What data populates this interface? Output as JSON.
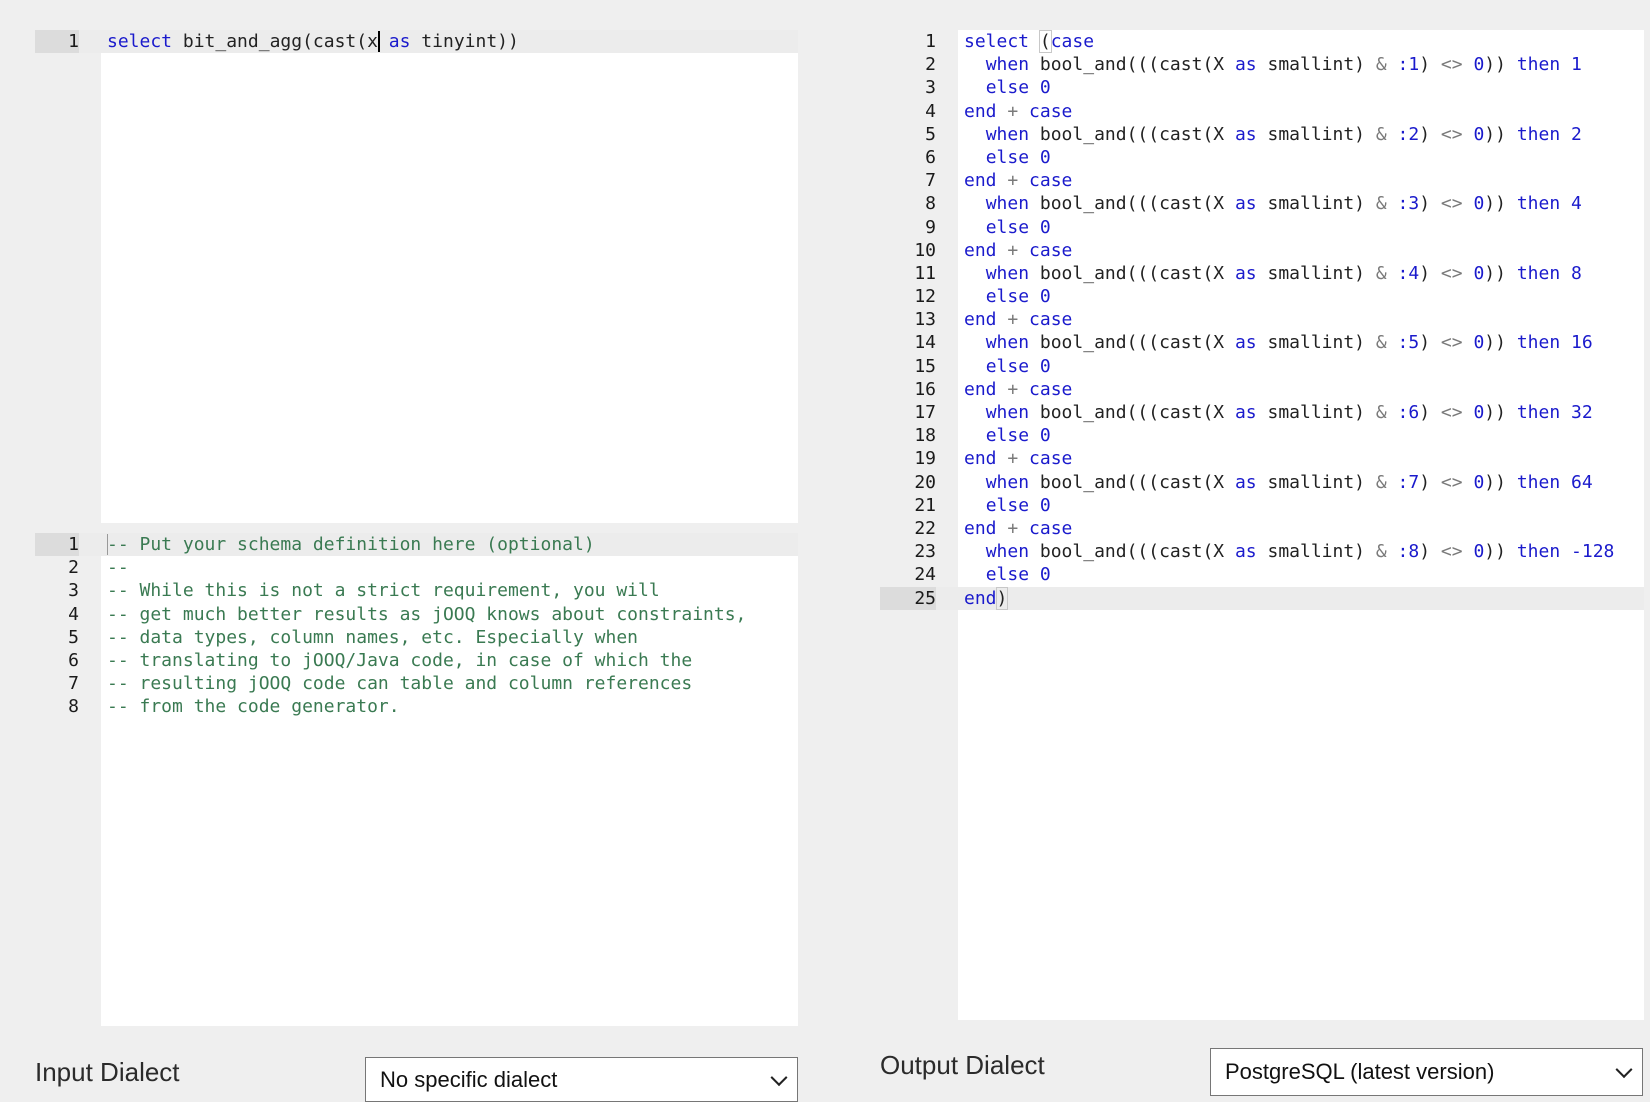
{
  "input_query": {
    "lines": [
      [
        {
          "t": "select",
          "c": "kw"
        },
        {
          "t": " bit_and_agg(cast(x",
          "c": "plain"
        },
        {
          "t": "",
          "c": "cursor"
        },
        {
          "t": " ",
          "c": "plain"
        },
        {
          "t": "as",
          "c": "kw"
        },
        {
          "t": " tinyint))",
          "c": "plain"
        }
      ]
    ]
  },
  "schema_editor": {
    "lines": [
      [
        {
          "t": "",
          "c": "cursor-light"
        },
        {
          "t": "-- Put your schema definition here (optional)",
          "c": "cm"
        }
      ],
      [
        {
          "t": "--",
          "c": "cm"
        }
      ],
      [
        {
          "t": "-- While this is not a strict requirement, you will",
          "c": "cm"
        }
      ],
      [
        {
          "t": "-- get much better results as jOOQ knows about constraints,",
          "c": "cm"
        }
      ],
      [
        {
          "t": "-- data types, column names, etc. Especially when",
          "c": "cm"
        }
      ],
      [
        {
          "t": "-- translating to jOOQ/Java code, in case of which the",
          "c": "cm"
        }
      ],
      [
        {
          "t": "-- resulting jOOQ code can table and column references",
          "c": "cm"
        }
      ],
      [
        {
          "t": "-- from the code generator.",
          "c": "cm"
        }
      ]
    ]
  },
  "output_query": {
    "lines": [
      [
        {
          "t": "select",
          "c": "kw"
        },
        {
          "t": " ",
          "c": "plain"
        },
        {
          "t": "(",
          "c": "bracket"
        },
        {
          "t": "case",
          "c": "kw"
        }
      ],
      [
        {
          "t": "  ",
          "c": "plain"
        },
        {
          "t": "when",
          "c": "kw"
        },
        {
          "t": " bool_and(((cast(X ",
          "c": "plain"
        },
        {
          "t": "as",
          "c": "kw"
        },
        {
          "t": " smallint) ",
          "c": "plain"
        },
        {
          "t": "&",
          "c": "op"
        },
        {
          "t": " ",
          "c": "plain"
        },
        {
          "t": ":1",
          "c": "num"
        },
        {
          "t": ") ",
          "c": "plain"
        },
        {
          "t": "<>",
          "c": "op"
        },
        {
          "t": " ",
          "c": "plain"
        },
        {
          "t": "0",
          "c": "num"
        },
        {
          "t": ")) ",
          "c": "plain"
        },
        {
          "t": "then",
          "c": "kw"
        },
        {
          "t": " ",
          "c": "plain"
        },
        {
          "t": "1",
          "c": "num"
        }
      ],
      [
        {
          "t": "  ",
          "c": "plain"
        },
        {
          "t": "else",
          "c": "kw"
        },
        {
          "t": " ",
          "c": "plain"
        },
        {
          "t": "0",
          "c": "num"
        }
      ],
      [
        {
          "t": "end",
          "c": "kw"
        },
        {
          "t": " ",
          "c": "plain"
        },
        {
          "t": "+",
          "c": "op"
        },
        {
          "t": " ",
          "c": "plain"
        },
        {
          "t": "case",
          "c": "kw"
        }
      ],
      [
        {
          "t": "  ",
          "c": "plain"
        },
        {
          "t": "when",
          "c": "kw"
        },
        {
          "t": " bool_and(((cast(X ",
          "c": "plain"
        },
        {
          "t": "as",
          "c": "kw"
        },
        {
          "t": " smallint) ",
          "c": "plain"
        },
        {
          "t": "&",
          "c": "op"
        },
        {
          "t": " ",
          "c": "plain"
        },
        {
          "t": ":2",
          "c": "num"
        },
        {
          "t": ") ",
          "c": "plain"
        },
        {
          "t": "<>",
          "c": "op"
        },
        {
          "t": " ",
          "c": "plain"
        },
        {
          "t": "0",
          "c": "num"
        },
        {
          "t": ")) ",
          "c": "plain"
        },
        {
          "t": "then",
          "c": "kw"
        },
        {
          "t": " ",
          "c": "plain"
        },
        {
          "t": "2",
          "c": "num"
        }
      ],
      [
        {
          "t": "  ",
          "c": "plain"
        },
        {
          "t": "else",
          "c": "kw"
        },
        {
          "t": " ",
          "c": "plain"
        },
        {
          "t": "0",
          "c": "num"
        }
      ],
      [
        {
          "t": "end",
          "c": "kw"
        },
        {
          "t": " ",
          "c": "plain"
        },
        {
          "t": "+",
          "c": "op"
        },
        {
          "t": " ",
          "c": "plain"
        },
        {
          "t": "case",
          "c": "kw"
        }
      ],
      [
        {
          "t": "  ",
          "c": "plain"
        },
        {
          "t": "when",
          "c": "kw"
        },
        {
          "t": " bool_and(((cast(X ",
          "c": "plain"
        },
        {
          "t": "as",
          "c": "kw"
        },
        {
          "t": " smallint) ",
          "c": "plain"
        },
        {
          "t": "&",
          "c": "op"
        },
        {
          "t": " ",
          "c": "plain"
        },
        {
          "t": ":3",
          "c": "num"
        },
        {
          "t": ") ",
          "c": "plain"
        },
        {
          "t": "<>",
          "c": "op"
        },
        {
          "t": " ",
          "c": "plain"
        },
        {
          "t": "0",
          "c": "num"
        },
        {
          "t": ")) ",
          "c": "plain"
        },
        {
          "t": "then",
          "c": "kw"
        },
        {
          "t": " ",
          "c": "plain"
        },
        {
          "t": "4",
          "c": "num"
        }
      ],
      [
        {
          "t": "  ",
          "c": "plain"
        },
        {
          "t": "else",
          "c": "kw"
        },
        {
          "t": " ",
          "c": "plain"
        },
        {
          "t": "0",
          "c": "num"
        }
      ],
      [
        {
          "t": "end",
          "c": "kw"
        },
        {
          "t": " ",
          "c": "plain"
        },
        {
          "t": "+",
          "c": "op"
        },
        {
          "t": " ",
          "c": "plain"
        },
        {
          "t": "case",
          "c": "kw"
        }
      ],
      [
        {
          "t": "  ",
          "c": "plain"
        },
        {
          "t": "when",
          "c": "kw"
        },
        {
          "t": " bool_and(((cast(X ",
          "c": "plain"
        },
        {
          "t": "as",
          "c": "kw"
        },
        {
          "t": " smallint) ",
          "c": "plain"
        },
        {
          "t": "&",
          "c": "op"
        },
        {
          "t": " ",
          "c": "plain"
        },
        {
          "t": ":4",
          "c": "num"
        },
        {
          "t": ") ",
          "c": "plain"
        },
        {
          "t": "<>",
          "c": "op"
        },
        {
          "t": " ",
          "c": "plain"
        },
        {
          "t": "0",
          "c": "num"
        },
        {
          "t": ")) ",
          "c": "plain"
        },
        {
          "t": "then",
          "c": "kw"
        },
        {
          "t": " ",
          "c": "plain"
        },
        {
          "t": "8",
          "c": "num"
        }
      ],
      [
        {
          "t": "  ",
          "c": "plain"
        },
        {
          "t": "else",
          "c": "kw"
        },
        {
          "t": " ",
          "c": "plain"
        },
        {
          "t": "0",
          "c": "num"
        }
      ],
      [
        {
          "t": "end",
          "c": "kw"
        },
        {
          "t": " ",
          "c": "plain"
        },
        {
          "t": "+",
          "c": "op"
        },
        {
          "t": " ",
          "c": "plain"
        },
        {
          "t": "case",
          "c": "kw"
        }
      ],
      [
        {
          "t": "  ",
          "c": "plain"
        },
        {
          "t": "when",
          "c": "kw"
        },
        {
          "t": " bool_and(((cast(X ",
          "c": "plain"
        },
        {
          "t": "as",
          "c": "kw"
        },
        {
          "t": " smallint) ",
          "c": "plain"
        },
        {
          "t": "&",
          "c": "op"
        },
        {
          "t": " ",
          "c": "plain"
        },
        {
          "t": ":5",
          "c": "num"
        },
        {
          "t": ") ",
          "c": "plain"
        },
        {
          "t": "<>",
          "c": "op"
        },
        {
          "t": " ",
          "c": "plain"
        },
        {
          "t": "0",
          "c": "num"
        },
        {
          "t": ")) ",
          "c": "plain"
        },
        {
          "t": "then",
          "c": "kw"
        },
        {
          "t": " ",
          "c": "plain"
        },
        {
          "t": "16",
          "c": "num"
        }
      ],
      [
        {
          "t": "  ",
          "c": "plain"
        },
        {
          "t": "else",
          "c": "kw"
        },
        {
          "t": " ",
          "c": "plain"
        },
        {
          "t": "0",
          "c": "num"
        }
      ],
      [
        {
          "t": "end",
          "c": "kw"
        },
        {
          "t": " ",
          "c": "plain"
        },
        {
          "t": "+",
          "c": "op"
        },
        {
          "t": " ",
          "c": "plain"
        },
        {
          "t": "case",
          "c": "kw"
        }
      ],
      [
        {
          "t": "  ",
          "c": "plain"
        },
        {
          "t": "when",
          "c": "kw"
        },
        {
          "t": " bool_and(((cast(X ",
          "c": "plain"
        },
        {
          "t": "as",
          "c": "kw"
        },
        {
          "t": " smallint) ",
          "c": "plain"
        },
        {
          "t": "&",
          "c": "op"
        },
        {
          "t": " ",
          "c": "plain"
        },
        {
          "t": ":6",
          "c": "num"
        },
        {
          "t": ") ",
          "c": "plain"
        },
        {
          "t": "<>",
          "c": "op"
        },
        {
          "t": " ",
          "c": "plain"
        },
        {
          "t": "0",
          "c": "num"
        },
        {
          "t": ")) ",
          "c": "plain"
        },
        {
          "t": "then",
          "c": "kw"
        },
        {
          "t": " ",
          "c": "plain"
        },
        {
          "t": "32",
          "c": "num"
        }
      ],
      [
        {
          "t": "  ",
          "c": "plain"
        },
        {
          "t": "else",
          "c": "kw"
        },
        {
          "t": " ",
          "c": "plain"
        },
        {
          "t": "0",
          "c": "num"
        }
      ],
      [
        {
          "t": "end",
          "c": "kw"
        },
        {
          "t": " ",
          "c": "plain"
        },
        {
          "t": "+",
          "c": "op"
        },
        {
          "t": " ",
          "c": "plain"
        },
        {
          "t": "case",
          "c": "kw"
        }
      ],
      [
        {
          "t": "  ",
          "c": "plain"
        },
        {
          "t": "when",
          "c": "kw"
        },
        {
          "t": " bool_and(((cast(X ",
          "c": "plain"
        },
        {
          "t": "as",
          "c": "kw"
        },
        {
          "t": " smallint) ",
          "c": "plain"
        },
        {
          "t": "&",
          "c": "op"
        },
        {
          "t": " ",
          "c": "plain"
        },
        {
          "t": ":7",
          "c": "num"
        },
        {
          "t": ") ",
          "c": "plain"
        },
        {
          "t": "<>",
          "c": "op"
        },
        {
          "t": " ",
          "c": "plain"
        },
        {
          "t": "0",
          "c": "num"
        },
        {
          "t": ")) ",
          "c": "plain"
        },
        {
          "t": "then",
          "c": "kw"
        },
        {
          "t": " ",
          "c": "plain"
        },
        {
          "t": "64",
          "c": "num"
        }
      ],
      [
        {
          "t": "  ",
          "c": "plain"
        },
        {
          "t": "else",
          "c": "kw"
        },
        {
          "t": " ",
          "c": "plain"
        },
        {
          "t": "0",
          "c": "num"
        }
      ],
      [
        {
          "t": "end",
          "c": "kw"
        },
        {
          "t": " ",
          "c": "plain"
        },
        {
          "t": "+",
          "c": "op"
        },
        {
          "t": " ",
          "c": "plain"
        },
        {
          "t": "case",
          "c": "kw"
        }
      ],
      [
        {
          "t": "  ",
          "c": "plain"
        },
        {
          "t": "when",
          "c": "kw"
        },
        {
          "t": " bool_and(((cast(X ",
          "c": "plain"
        },
        {
          "t": "as",
          "c": "kw"
        },
        {
          "t": " smallint) ",
          "c": "plain"
        },
        {
          "t": "&",
          "c": "op"
        },
        {
          "t": " ",
          "c": "plain"
        },
        {
          "t": ":8",
          "c": "num"
        },
        {
          "t": ") ",
          "c": "plain"
        },
        {
          "t": "<>",
          "c": "op"
        },
        {
          "t": " ",
          "c": "plain"
        },
        {
          "t": "0",
          "c": "num"
        },
        {
          "t": ")) ",
          "c": "plain"
        },
        {
          "t": "then",
          "c": "kw"
        },
        {
          "t": " ",
          "c": "plain"
        },
        {
          "t": "-128",
          "c": "num"
        }
      ],
      [
        {
          "t": "  ",
          "c": "plain"
        },
        {
          "t": "else",
          "c": "kw"
        },
        {
          "t": " ",
          "c": "plain"
        },
        {
          "t": "0",
          "c": "num"
        }
      ],
      [
        {
          "t": "end",
          "c": "kw"
        },
        {
          "t": ")",
          "c": "bracket"
        }
      ]
    ]
  },
  "input_dialect": {
    "label": "Input Dialect",
    "selected": "No specific dialect"
  },
  "output_dialect": {
    "label": "Output Dialect",
    "selected": "PostgreSQL (latest version)"
  },
  "colors": {
    "keyword": "#1a1acc",
    "comment": "#3a7a52",
    "operator": "#7a7a7a",
    "background": "#efefef"
  }
}
